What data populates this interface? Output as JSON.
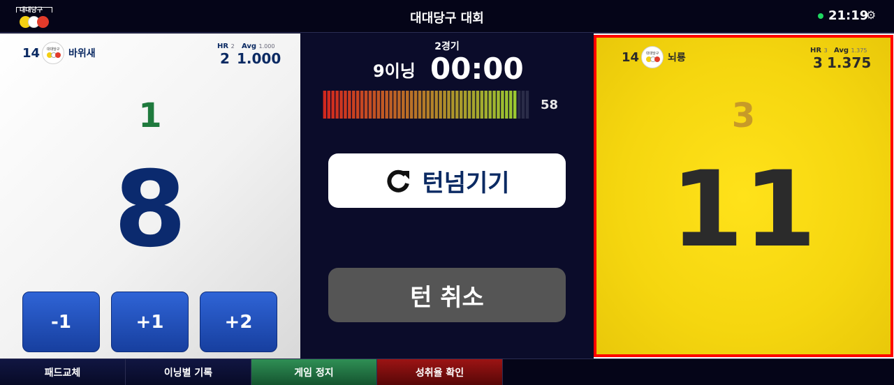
{
  "header": {
    "logo_text": "대대당구",
    "title": "대대당구 대회",
    "time": "21:19",
    "status_color": "#1ed760"
  },
  "left_player": {
    "number": "14",
    "name": "바위새",
    "hr_label": "HR",
    "hr_sub": "2",
    "hr_value": "2",
    "avg_label": "Avg",
    "avg_sub": "1.000",
    "avg_value": "1.000",
    "inning_score": "1",
    "score": "8",
    "buttons": [
      "-1",
      "+1",
      "+2"
    ]
  },
  "center": {
    "game": "2경기",
    "inning": "9이닝",
    "timer": "00:00",
    "meter_count": "58",
    "turn_label": "턴넘기기",
    "cancel_label": "턴 취소"
  },
  "right_player": {
    "number": "14",
    "name": "뇌룡",
    "hr_label": "HR",
    "hr_sub": "3",
    "hr_value": "3",
    "avg_label": "Avg",
    "avg_sub": "1.375",
    "avg_value": "1.375",
    "inning_score": "3",
    "score": "11",
    "highlight_color": "#ff0000",
    "panel_color": "#fde017"
  },
  "bottom": {
    "items": [
      "패드교체",
      "이닝별 기록",
      "게임 정지",
      "성취율 확인"
    ]
  },
  "colors": {
    "background": "#0b0c2a",
    "left_score": "#0b2a6e",
    "right_score": "#2b2b2b",
    "game_stop": "#2f8f55",
    "rate_check": "#9c1414"
  }
}
